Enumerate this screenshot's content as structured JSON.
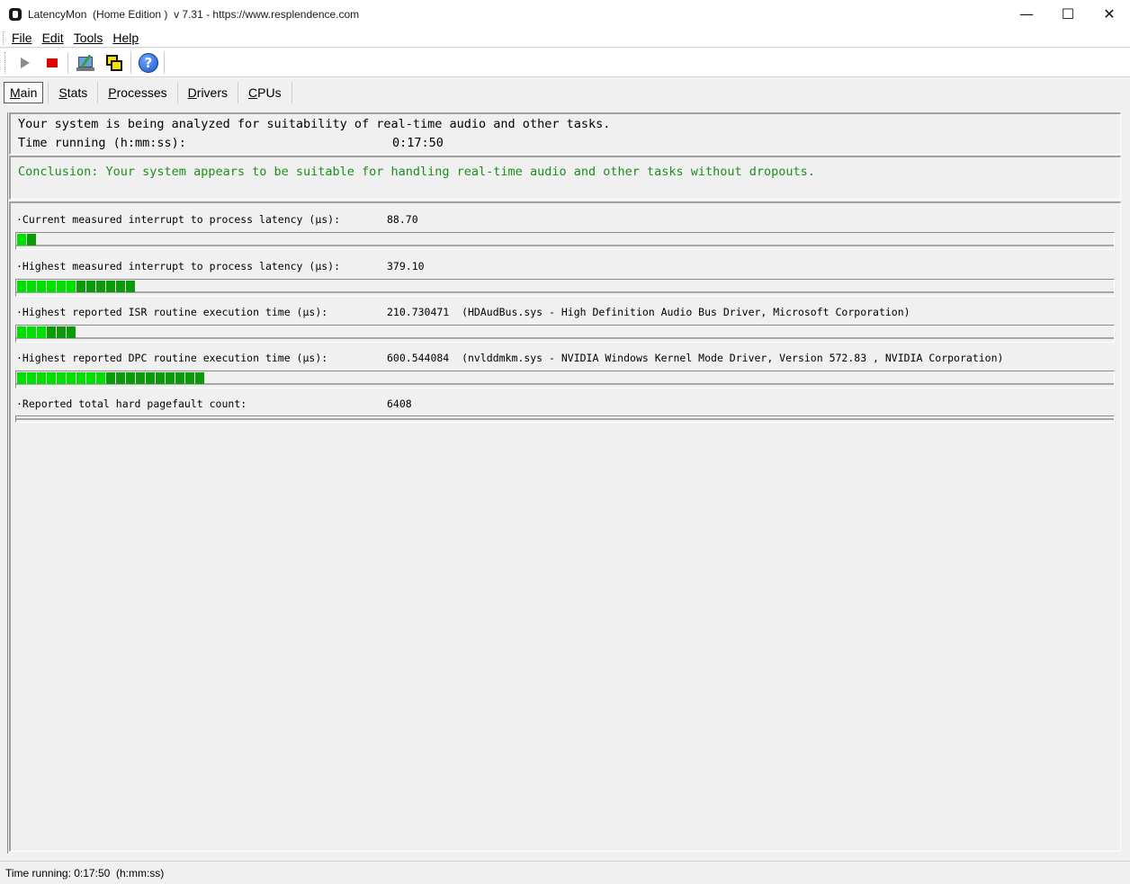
{
  "window": {
    "title": "LatencyMon  (Home Edition )  v 7.31 - https://www.resplendence.com",
    "minimize": "—",
    "maximize": "☐",
    "close": "✕"
  },
  "menu": {
    "file": "File",
    "edit": "Edit",
    "tools": "Tools",
    "help": "Help"
  },
  "toolbar": {
    "start": "play-icon",
    "stop": "stop-icon",
    "config": "system-config-icon",
    "windows": "cascade-windows-icon",
    "help": "?"
  },
  "tabs": [
    {
      "label": "Main",
      "active": true
    },
    {
      "label": "Stats",
      "active": false
    },
    {
      "label": "Processes",
      "active": false
    },
    {
      "label": "Drivers",
      "active": false
    },
    {
      "label": "CPUs",
      "active": false
    }
  ],
  "info": {
    "analyzing": "Your system is being analyzed for suitability of real-time audio and other tasks.",
    "time_label": "Time running (h:mm:ss):",
    "time_value": "0:17:50"
  },
  "conclusion": "Conclusion: Your system appears to be suitable for handling real-time audio and other tasks without dropouts.",
  "metrics": [
    {
      "label": "·Current measured interrupt to process latency (µs):",
      "value": "88.70",
      "segments": 2
    },
    {
      "label": "·Highest measured interrupt to process latency (µs):",
      "value": "379.10",
      "segments": 12
    },
    {
      "label": "·Highest reported ISR routine execution time (µs):",
      "value": "210.730471  (HDAudBus.sys - High Definition Audio Bus Driver, Microsoft Corporation)",
      "segments": 6
    },
    {
      "label": "·Highest reported DPC routine execution time (µs):",
      "value": "600.544084  (nvlddmkm.sys - NVIDIA Windows Kernel Mode Driver, Version 572.83 , NVIDIA Corporation)",
      "segments": 19
    },
    {
      "label": "·Reported total hard pagefault count:",
      "value": "6408",
      "segments": 0
    }
  ],
  "colors": {
    "bar_green_light": "#00e000",
    "bar_green_dark": "#0a9a0a",
    "conclusion_green": "#1a8f1a"
  },
  "status": "Time running: 0:17:50  (h:mm:ss)"
}
